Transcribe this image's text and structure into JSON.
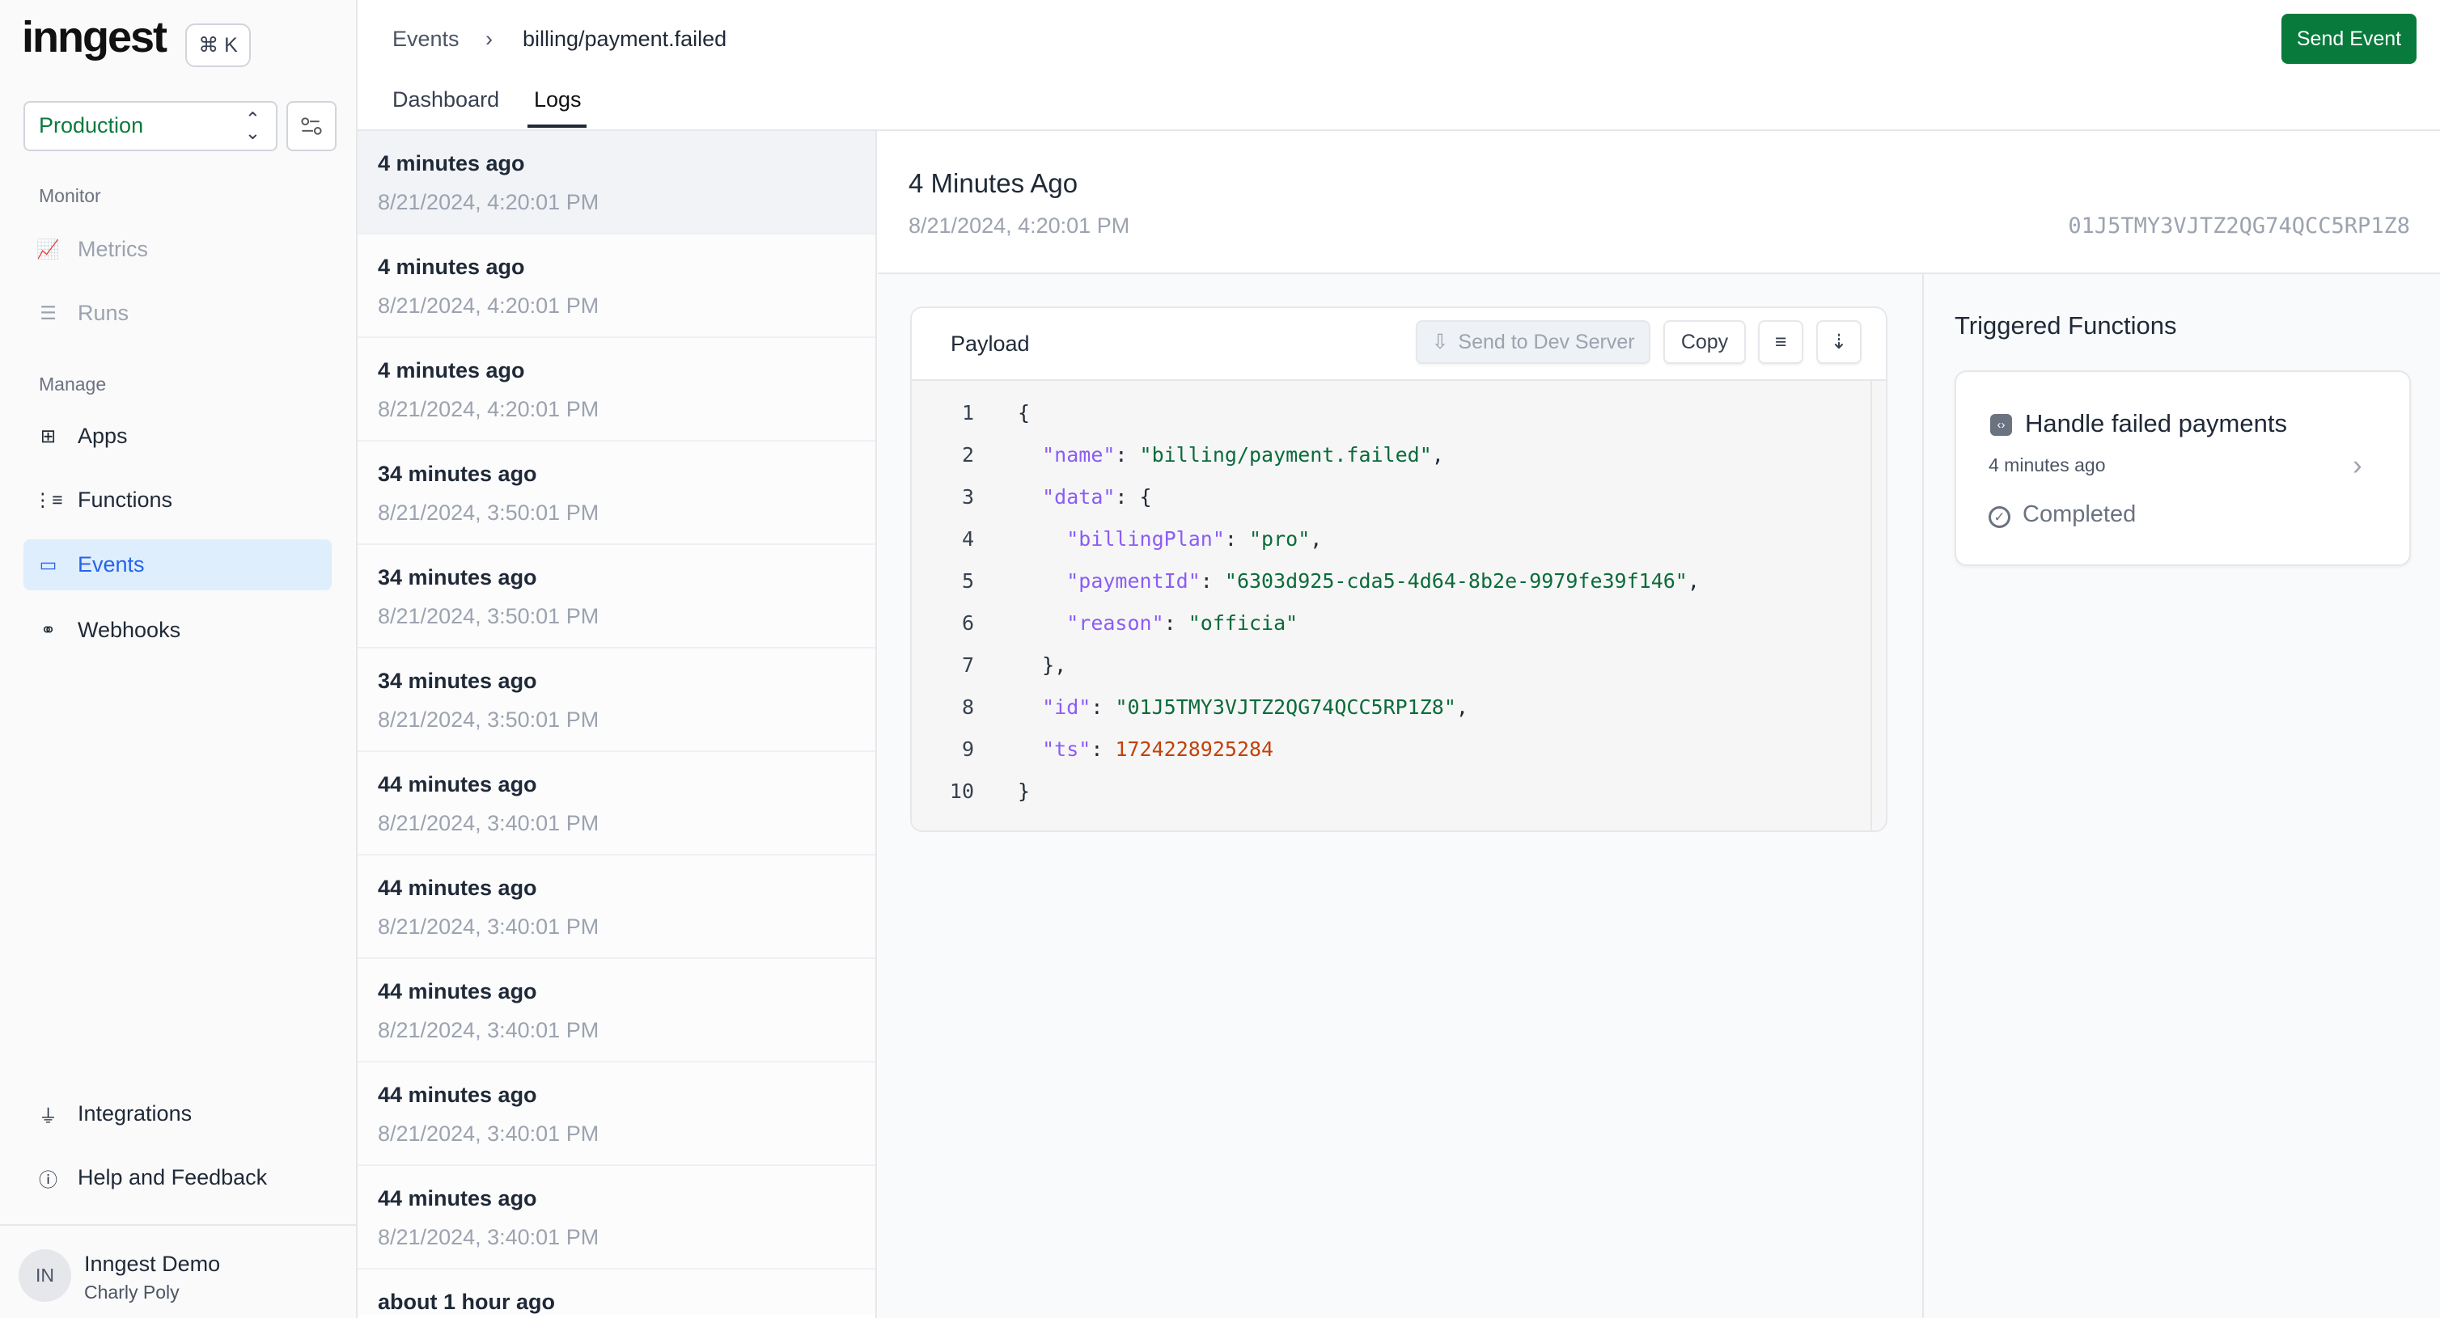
{
  "brand": {
    "logo": "inngest",
    "shortcut": "⌘ K"
  },
  "env": {
    "selected": "Production"
  },
  "sidebar": {
    "monitor_label": "Monitor",
    "manage_label": "Manage",
    "monitor": [
      {
        "label": "Metrics",
        "icon": "chart-line-icon"
      },
      {
        "label": "Runs",
        "icon": "runs-list-icon"
      }
    ],
    "manage": [
      {
        "label": "Apps",
        "icon": "apps-grid-icon"
      },
      {
        "label": "Functions",
        "icon": "functions-list-icon"
      },
      {
        "label": "Events",
        "icon": "events-icon",
        "active": true
      },
      {
        "label": "Webhooks",
        "icon": "webhook-icon"
      }
    ],
    "bottom": [
      {
        "label": "Integrations",
        "icon": "plug-icon"
      },
      {
        "label": "Help and Feedback",
        "icon": "help-circle-icon"
      }
    ],
    "user": {
      "initials": "IN",
      "org": "Inngest Demo",
      "name": "Charly Poly"
    }
  },
  "header": {
    "breadcrumb": [
      "Events",
      "billing/payment.failed"
    ],
    "send_event": "Send Event",
    "tabs": [
      "Dashboard",
      "Logs"
    ],
    "active_tab": "Logs"
  },
  "events": [
    {
      "ago": "4 minutes ago",
      "date": "8/21/2024, 4:20:01 PM"
    },
    {
      "ago": "4 minutes ago",
      "date": "8/21/2024, 4:20:01 PM"
    },
    {
      "ago": "4 minutes ago",
      "date": "8/21/2024, 4:20:01 PM"
    },
    {
      "ago": "34 minutes ago",
      "date": "8/21/2024, 3:50:01 PM"
    },
    {
      "ago": "34 minutes ago",
      "date": "8/21/2024, 3:50:01 PM"
    },
    {
      "ago": "34 minutes ago",
      "date": "8/21/2024, 3:50:01 PM"
    },
    {
      "ago": "44 minutes ago",
      "date": "8/21/2024, 3:40:01 PM"
    },
    {
      "ago": "44 minutes ago",
      "date": "8/21/2024, 3:40:01 PM"
    },
    {
      "ago": "44 minutes ago",
      "date": "8/21/2024, 3:40:01 PM"
    },
    {
      "ago": "44 minutes ago",
      "date": "8/21/2024, 3:40:01 PM"
    },
    {
      "ago": "44 minutes ago",
      "date": "8/21/2024, 3:40:01 PM"
    },
    {
      "ago": "about 1 hour ago",
      "date": ""
    }
  ],
  "detail": {
    "title": "4 Minutes Ago",
    "date": "8/21/2024, 4:20:01 PM",
    "id": "01J5TMY3VJTZ2QG74QCC5RP1Z8"
  },
  "payload": {
    "title": "Payload",
    "send_dev": "Send to Dev Server",
    "copy": "Copy",
    "lines": [
      [
        [
          "p",
          "{"
        ]
      ],
      [
        [
          "p",
          "  "
        ],
        [
          "k",
          "\"name\""
        ],
        [
          "p",
          ": "
        ],
        [
          "s",
          "\"billing/payment.failed\""
        ],
        [
          "p",
          ","
        ]
      ],
      [
        [
          "p",
          "  "
        ],
        [
          "k",
          "\"data\""
        ],
        [
          "p",
          ": {"
        ]
      ],
      [
        [
          "p",
          "    "
        ],
        [
          "k",
          "\"billingPlan\""
        ],
        [
          "p",
          ": "
        ],
        [
          "s",
          "\"pro\""
        ],
        [
          "p",
          ","
        ]
      ],
      [
        [
          "p",
          "    "
        ],
        [
          "k",
          "\"paymentId\""
        ],
        [
          "p",
          ": "
        ],
        [
          "s",
          "\"6303d925-cda5-4d64-8b2e-9979fe39f146\""
        ],
        [
          "p",
          ","
        ]
      ],
      [
        [
          "p",
          "    "
        ],
        [
          "k",
          "\"reason\""
        ],
        [
          "p",
          ": "
        ],
        [
          "s",
          "\"officia\""
        ]
      ],
      [
        [
          "p",
          "  },"
        ]
      ],
      [
        [
          "p",
          "  "
        ],
        [
          "k",
          "\"id\""
        ],
        [
          "p",
          ": "
        ],
        [
          "s",
          "\"01J5TMY3VJTZ2QG74QCC5RP1Z8\""
        ],
        [
          "p",
          ","
        ]
      ],
      [
        [
          "p",
          "  "
        ],
        [
          "k",
          "\"ts\""
        ],
        [
          "p",
          ": "
        ],
        [
          "n",
          "1724228925284"
        ]
      ],
      [
        [
          "p",
          "}"
        ]
      ]
    ]
  },
  "triggered": {
    "title": "Triggered Functions",
    "function": {
      "name": "Handle failed payments",
      "ago": "4 minutes ago",
      "status": "Completed"
    }
  },
  "colors": {
    "accent": "#087a3c",
    "active_nav": "#2563eb",
    "key": "#8b5cf6",
    "string": "#0b6b3a",
    "number": "#c2410c"
  }
}
